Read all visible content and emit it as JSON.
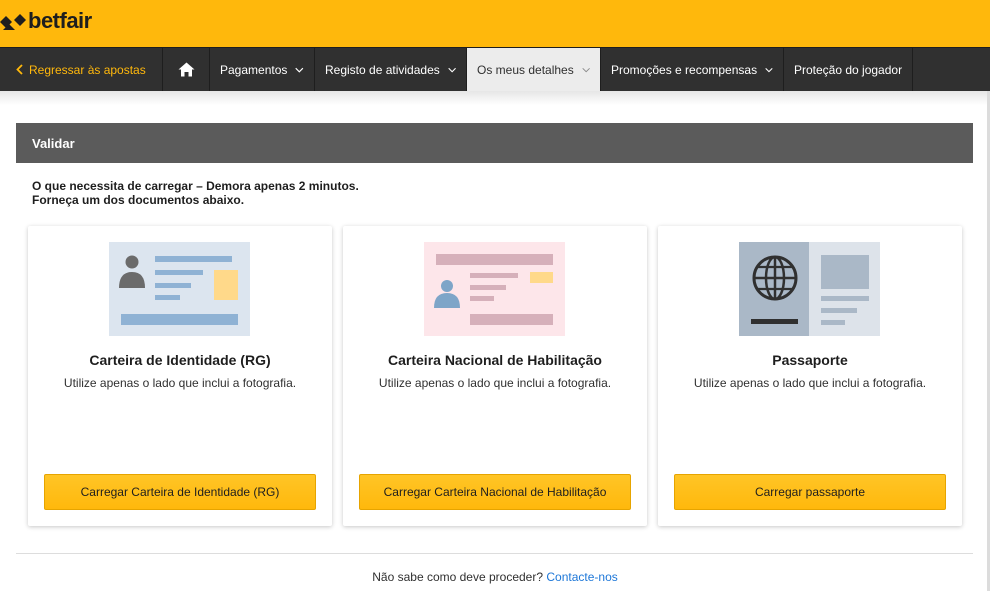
{
  "brand": {
    "logo_text": "betfair",
    "color": "#ffb80c"
  },
  "nav": {
    "back_label": "Regressar às apostas",
    "home_icon": "home-icon",
    "items": [
      {
        "label": "Pagamentos",
        "has_dropdown": true
      },
      {
        "label": "Registo de atividades",
        "has_dropdown": true
      },
      {
        "label": "Os meus detalhes",
        "has_dropdown": true,
        "active": true
      },
      {
        "label": "Promoções e recompensas",
        "has_dropdown": true
      },
      {
        "label": "Proteção do jogador",
        "has_dropdown": false
      }
    ]
  },
  "section": {
    "title": "Validar",
    "intro_line1": "O que necessita de carregar – Demora apenas 2 minutos.",
    "intro_line2": "Forneça um dos documentos abaixo."
  },
  "cards": [
    {
      "title": "Carteira de Identidade (RG)",
      "description": "Utilize apenas o lado que inclui a fotografia.",
      "button": "Carregar Carteira de Identidade (RG)",
      "icon": "id-card-icon"
    },
    {
      "title": "Carteira Nacional de Habilitação",
      "description": "Utilize apenas o lado que inclui a fotografia.",
      "button": "Carregar Carteira Nacional de Habilitação",
      "icon": "driver-license-icon"
    },
    {
      "title": "Passaporte",
      "description": "Utilize apenas o lado que inclui a fotografia.",
      "button": "Carregar passaporte",
      "icon": "passport-icon"
    }
  ],
  "help": {
    "question": "Não sabe como deve proceder?",
    "link": "Contacte-nos"
  }
}
